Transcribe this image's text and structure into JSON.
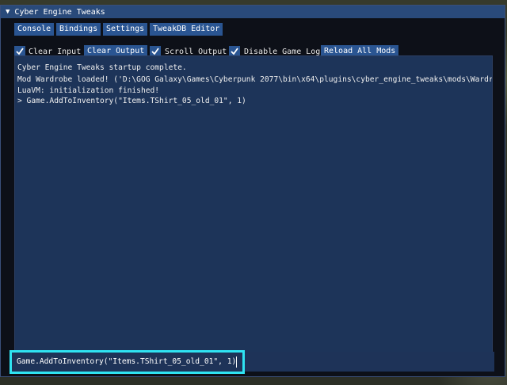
{
  "window": {
    "title": "Cyber Engine Tweaks"
  },
  "tabs": [
    "Console",
    "Bindings",
    "Settings",
    "TweakDB Editor"
  ],
  "toolbar": {
    "clear_input_label": "Clear Input",
    "clear_output_button": "Clear Output",
    "scroll_output_label": "Scroll Output",
    "disable_game_log_label": "Disable Game Log",
    "reload_all_mods_button": "Reload All Mods"
  },
  "console": {
    "lines": [
      "Cyber Engine Tweaks startup complete.",
      "Mod Wardrobe loaded! ('D:\\GOG Galaxy\\Games\\Cyberpunk 2077\\bin\\x64\\plugins\\cyber_engine_tweaks\\mods\\Wardro",
      "LuaVM: initialization finished!",
      "> Game.AddToInventory(\"Items.TShirt_05_old_01\", 1)"
    ]
  },
  "input": {
    "value": "Game.AddToInventory(\"Items.TShirt_05_old_01\", 1)"
  },
  "colors": {
    "accent": "#2a5592",
    "console_bg": "#1d3459",
    "highlight": "#2fe3f2"
  },
  "icons": {
    "collapse": "triangle-down-icon",
    "check": "checkmark-icon"
  }
}
